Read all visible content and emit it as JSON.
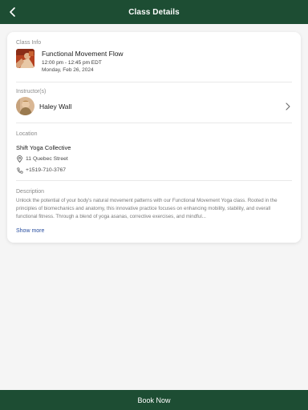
{
  "header": {
    "title": "Class Details",
    "back_icon": "chevron-left-icon"
  },
  "class_info": {
    "label": "Class Info",
    "title": "Functional Movement Flow",
    "time": "12:00 pm - 12:45 pm EDT",
    "date": "Monday, Feb 26, 2024"
  },
  "instructors": {
    "label": "Instructor(s)",
    "name": "Haley Wall"
  },
  "location": {
    "label": "Location",
    "name": "Shift Yoga Collective",
    "address": "11 Quebec Street",
    "phone": "+1519-710-3767"
  },
  "description": {
    "label": "Description",
    "text": "Unlock the potential of your body's natural movement patterns with our Functional Movement Yoga class. Rooted in the principles of biomechanics and anatomy, this innovative practice focuses on enhancing mobility, stability, and overall functional fitness. Through a blend of yoga asanas, corrective exercises, and mindful...",
    "show_more": "Show more"
  },
  "footer": {
    "book_label": "Book Now"
  },
  "colors": {
    "brand": "#1d4d33",
    "link": "#2a4fa0"
  }
}
